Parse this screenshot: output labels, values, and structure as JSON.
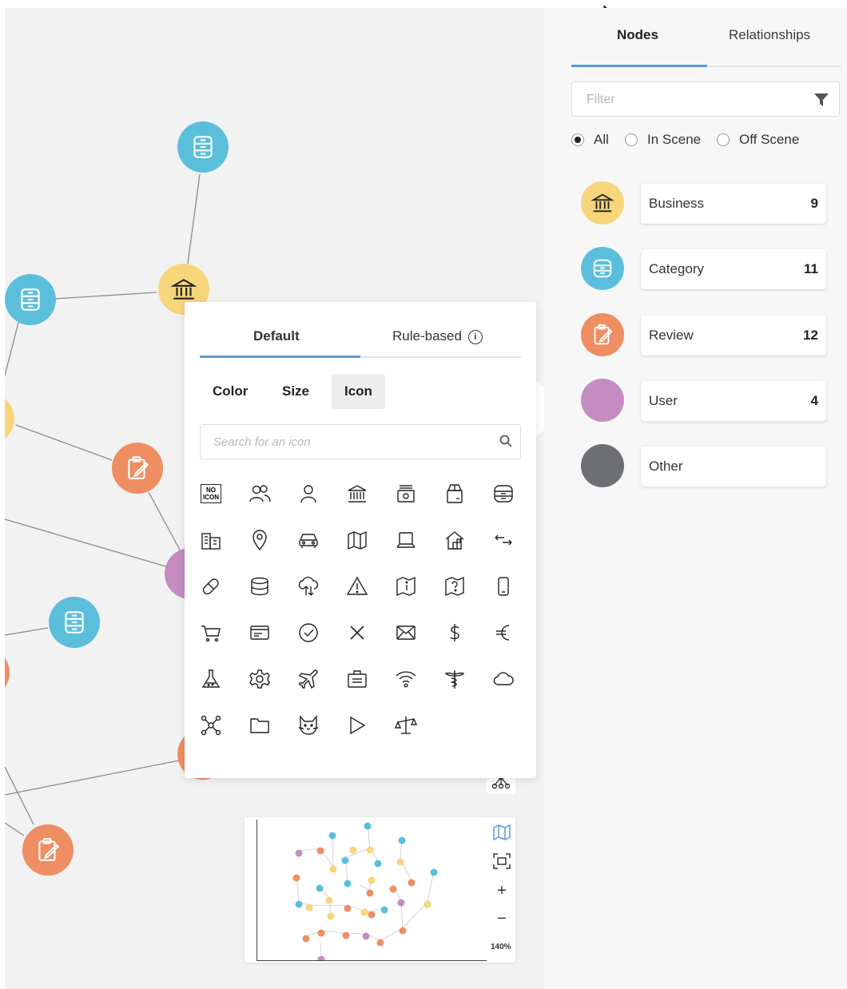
{
  "colors": {
    "business": "#f7d57a",
    "category": "#5bbfdc",
    "review": "#ef8d63",
    "user": "#c48cc0",
    "other": "#6e6f73",
    "accent": "#5b9bd5"
  },
  "sidebar": {
    "tabs": [
      {
        "label": "Nodes",
        "active": true
      },
      {
        "label": "Relationships",
        "active": false
      }
    ],
    "filter": {
      "placeholder": "Filter",
      "icon": "filter-icon"
    },
    "scope": {
      "options": [
        "All",
        "In Scene",
        "Off Scene"
      ],
      "selected": "All"
    },
    "categories": [
      {
        "name": "Business",
        "count": "9",
        "icon": "bank-icon"
      },
      {
        "name": "Category",
        "count": "11",
        "icon": "drawers-icon"
      },
      {
        "name": "Review",
        "count": "12",
        "icon": "edit-note-icon"
      },
      {
        "name": "User",
        "count": "4",
        "icon": ""
      },
      {
        "name": "Other",
        "count": "",
        "icon": ""
      }
    ]
  },
  "style_panel": {
    "tabs": [
      {
        "label": "Default",
        "active": true
      },
      {
        "label": "Rule-based",
        "active": false
      }
    ],
    "subtabs": [
      {
        "label": "Color",
        "active": false
      },
      {
        "label": "Size",
        "active": false
      },
      {
        "label": "Icon",
        "active": true
      }
    ],
    "search": {
      "placeholder": "Search for an icon"
    },
    "no_icon_label": [
      "NO",
      "ICON"
    ],
    "icons": [
      "no-icon",
      "users-icon",
      "user-icon",
      "bank-icon",
      "register-icon",
      "box-icon",
      "drawers-icon",
      "buildings-icon",
      "location-pin-icon",
      "car-icon",
      "map-icon",
      "laptop-icon",
      "house-icon",
      "swap-arrows-icon",
      "pill-icon",
      "database-icon",
      "cloud-sync-icon",
      "warning-icon",
      "info-map-icon",
      "question-map-icon",
      "phone-icon",
      "cart-icon",
      "card-icon",
      "check-circle-icon",
      "close-icon",
      "mail-icon",
      "dollar-icon",
      "euro-icon",
      "flask-icon",
      "gear-icon",
      "plane-icon",
      "briefcase-icon",
      "wifi-icon",
      "caduceus-icon",
      "cloud-icon",
      "network-icon",
      "folder-icon",
      "cat-icon",
      "play-icon",
      "scales-icon"
    ]
  },
  "minimap": {
    "zoom": "140%",
    "tools": [
      "map-icon",
      "fit-screen-icon",
      "zoom-in-icon",
      "zoom-out-icon"
    ]
  }
}
